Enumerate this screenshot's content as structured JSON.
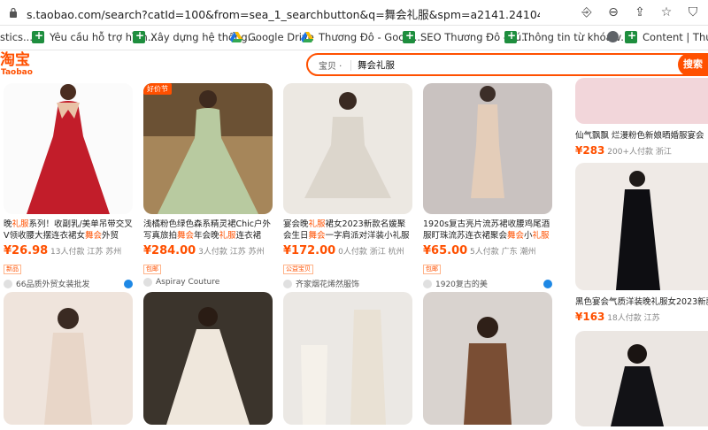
{
  "browser": {
    "url": "s.taobao.com/search?catId=100&from=sea_1_searchbutton&q=舞会礼服&spm=a2141.241046-vn.searchbar.d_2_searchbox&tmh...",
    "bookmarks": [
      {
        "label": "stics...",
        "icon": "none"
      },
      {
        "label": "Yêu cầu hỗ trợ hình...",
        "icon": "green-plus-icon"
      },
      {
        "label": "Xây dựng hệ thống...",
        "icon": "green-plus-icon"
      },
      {
        "label": "Google Drive",
        "icon": "drive-icon"
      },
      {
        "label": "Thương Đô - Googl...",
        "icon": "drive-icon"
      },
      {
        "label": "SEO Thương Đô - Tú...",
        "icon": "green-plus-icon"
      },
      {
        "label": "Thông tin từ khóa v...",
        "icon": "green-plus-icon"
      },
      {
        "label": "",
        "icon": "globe-icon"
      },
      {
        "label": "Content | Thuongd",
        "icon": "green-plus-icon"
      }
    ]
  },
  "taobao": {
    "logo_cn": "淘宝",
    "logo_en": "Taobao",
    "search_category": "宝贝 ·",
    "search_query": "舞会礼服",
    "search_button": "搜索"
  },
  "products": [
    {
      "title_pre": "晚",
      "title_hl": "礼服",
      "title_post": "系列！收副乳/美单吊带交叉V领收腰大摆连衣裙女",
      "title_hl2": "舞会",
      "title_end": "外贸",
      "price": "26.98",
      "sold": "13人付款",
      "loc": "江苏 苏州",
      "badge": "新品",
      "shop": "66品质外贸女装批发"
    },
    {
      "tag": "好价节",
      "title_pre": "浅橘粉色绿色森系精灵裙Chic户外写真旅拍",
      "title_hl": "舞会",
      "title_post": "年会晚",
      "title_hl2": "礼服",
      "title_end": "连衣裙",
      "price": "284.00",
      "sold": "3人付款",
      "loc": "江苏 苏州",
      "badge": "包邮",
      "shop": "Aspiray Couture"
    },
    {
      "title_pre": "宴会晚",
      "title_hl": "礼服",
      "title_post": "裙女2023新款名媛聚会生日",
      "title_hl2": "舞会",
      "title_end": "一字肩派对洋装小礼服",
      "price": "172.00",
      "sold": "0人付款",
      "loc": "浙江 杭州",
      "badge": "公益宝贝",
      "shop": "齐家烟花烯然服饰"
    },
    {
      "title_pre": "1920s复古亮片流苏裙收腰鸡尾酒服盯珠流苏连衣裙聚会",
      "title_hl": "舞会",
      "title_post": "小",
      "title_hl2": "礼服",
      "title_end": "",
      "price": "65.00",
      "sold": "5人付款",
      "loc": "广东 潮州",
      "badge": "包邮",
      "shop": "1920复古的美"
    }
  ],
  "right_column": [
    {
      "title": "仙气飘飘 烂漫粉色新娘晒婚服宴会",
      "price": "283",
      "sold": "200+人付款",
      "loc": "浙江"
    },
    {
      "title": "黑色宴会气质洋装晚礼服女2023新款",
      "price": "163",
      "sold": "18人付款",
      "loc": "江苏"
    }
  ],
  "icons": {
    "lock": "lock-icon",
    "translate": "translate-icon",
    "zoom": "zoom-icon",
    "share": "share-icon",
    "star": "star-icon",
    "shield": "shield-icon"
  },
  "colors": {
    "accent": "#ff5000",
    "green": "#1e8e3e"
  }
}
